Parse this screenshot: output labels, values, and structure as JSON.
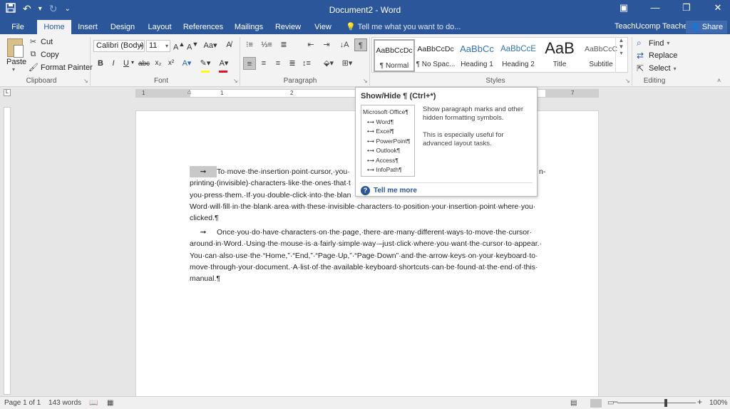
{
  "titlebar": {
    "title": "Document2 - Word",
    "qat": {
      "save_icon": "save-icon",
      "undo_icon": "undo-icon",
      "redo_icon": "redo-icon"
    },
    "controls": [
      "minimize-icon",
      "restore-icon",
      "close-icon"
    ]
  },
  "tabs": [
    "File",
    "Home",
    "Insert",
    "Design",
    "Layout",
    "References",
    "Mailings",
    "Review",
    "View"
  ],
  "active_tab": "Home",
  "tell_me": "Tell me what you want to do...",
  "user": "TeachUcomp Teacher",
  "share": "Share",
  "clipboard": {
    "paste": "Paste",
    "cut": "Cut",
    "copy": "Copy",
    "format_painter": "Format Painter",
    "label": "Clipboard"
  },
  "font": {
    "name": "Calibri (Body)",
    "size": "11",
    "label": "Font",
    "highlight_color": "#ffff00",
    "font_color": "#e81123"
  },
  "paragraph": {
    "label": "Paragraph"
  },
  "styles": {
    "label": "Styles",
    "items": [
      {
        "sample": "AaBbCcDc",
        "name": "¶ Normal"
      },
      {
        "sample": "AaBbCcDc",
        "name": "¶ No Spac..."
      },
      {
        "sample": "AaBbCc",
        "name": "Heading 1"
      },
      {
        "sample": "AaBbCcE",
        "name": "Heading 2"
      },
      {
        "sample": "AaB",
        "name": "Title"
      },
      {
        "sample": "AaBbCcC",
        "name": "Subtitle"
      }
    ]
  },
  "editing": {
    "find": "Find",
    "replace": "Replace",
    "select": "Select",
    "label": "Editing"
  },
  "ruler": {
    "numbers": [
      "1",
      "1",
      "2",
      "7"
    ]
  },
  "tooltip": {
    "title": "Show/Hide ¶ (Ctrl+*)",
    "sample_head": "Microsoft·Office¶",
    "sample_items": [
      "Word¶",
      "Excel¶",
      "PowerPoint¶",
      "Outlook¶",
      "Access¶",
      "InfoPath¶"
    ],
    "desc1": "Show paragraph marks and other hidden formatting symbols.",
    "desc2": "This is especially useful for advanced layout tasks.",
    "more": "Tell me more"
  },
  "document": {
    "p1": [
      "To·move·the·insertion·point·cursor,·you·",
      "printing·(invisible)·characters·like·the·ones·that·t",
      "you·press·them.·If·you·double-click·into·the·blan",
      "Word·will·fill·in·the·blank·area·with·these·invisible·characters·to·position·your·insertion·point·where·you·",
      "clicked.¶"
    ],
    "p1_tail": "n-",
    "p2": [
      "Once·you·do·have·characters·on·the·page,·there·are·many·different·ways·to·move·the·cursor·",
      "around·in·Word.·Using·the·mouse·is·a·fairly·simple·way·–just·click·where·you·want·the·cursor·to·appear.·",
      "You·can·also·use·the·“Home,”·“End,”·“Page·Up,”·“Page·Down”·and·the·arrow·keys·on·your·keyboard·to·",
      "move·through·your·document.·A·list·of·the·available·keyboard·shortcuts·can·be·found·at·the·end·of·this·",
      "manual.¶"
    ]
  },
  "status": {
    "page": "Page 1 of 1",
    "words": "143 words",
    "zoom": "100%",
    "zoom_level": 0.5
  }
}
